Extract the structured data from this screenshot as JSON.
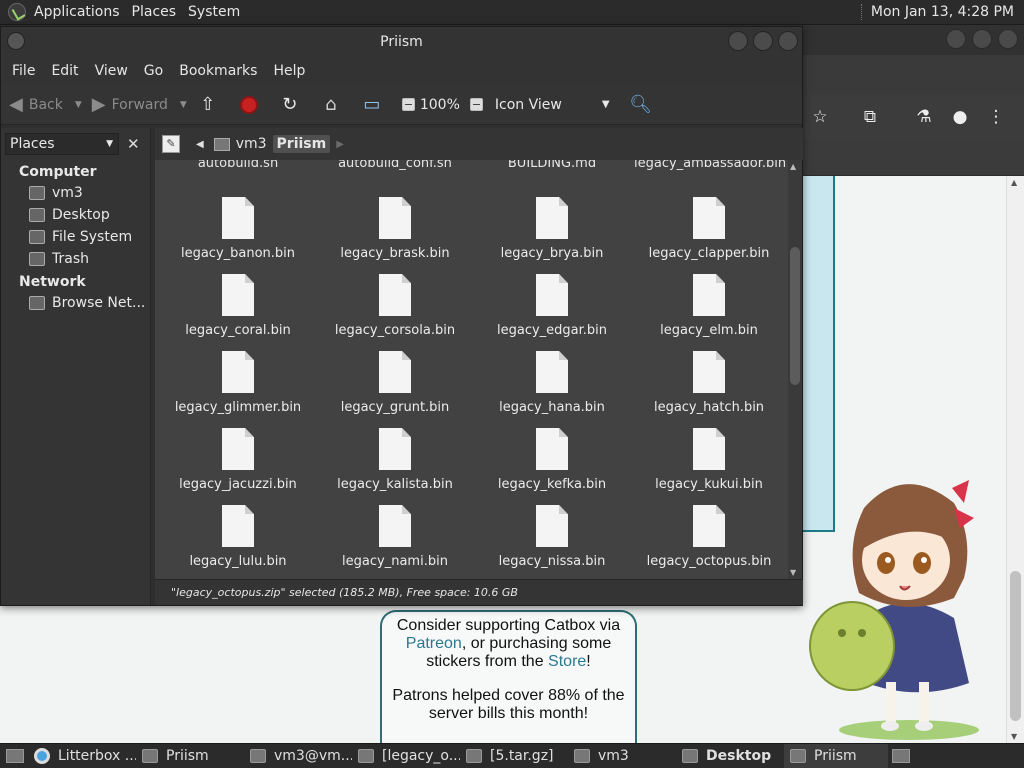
{
  "top_panel": {
    "menus": [
      "Applications",
      "Places",
      "System"
    ],
    "clock": "Mon Jan 13,  4:28 PM"
  },
  "browser": {
    "support": {
      "line1_pre": "Consider supporting Catbox via",
      "patreon": "Patreon",
      "line2_mid": ", or purchasing some",
      "line3_pre": "stickers from the ",
      "store": "Store",
      "line3_post": "!",
      "patrons": "Patrons helped cover 88% of the server bills this month!"
    }
  },
  "file_manager": {
    "title": "Priism",
    "menus": [
      "File",
      "Edit",
      "View",
      "Go",
      "Bookmarks",
      "Help"
    ],
    "toolbar": {
      "back": "Back",
      "forward": "Forward",
      "zoom": "100%",
      "view_mode": "Icon View"
    },
    "sidebar": {
      "selector": "Places",
      "categories": [
        {
          "label": "Computer",
          "items": [
            "vm3",
            "Desktop",
            "File System",
            "Trash"
          ]
        },
        {
          "label": "Network",
          "items": [
            "Browse Net..."
          ]
        }
      ]
    },
    "path": [
      "vm3",
      "Priism"
    ],
    "partial_files": [
      "autobuild.sh",
      "autobuild_conf.sh",
      "BUILDING.md",
      "legacy_ambassador.bin"
    ],
    "files": [
      "legacy_banon.bin",
      "legacy_brask.bin",
      "legacy_brya.bin",
      "legacy_clapper.bin",
      "legacy_coral.bin",
      "legacy_corsola.bin",
      "legacy_edgar.bin",
      "legacy_elm.bin",
      "legacy_glimmer.bin",
      "legacy_grunt.bin",
      "legacy_hana.bin",
      "legacy_hatch.bin",
      "legacy_jacuzzi.bin",
      "legacy_kalista.bin",
      "legacy_kefka.bin",
      "legacy_kukui.bin",
      "legacy_lulu.bin",
      "legacy_nami.bin",
      "legacy_nissa.bin",
      "legacy_octopus.bin"
    ],
    "status": "\"legacy_octopus.zip\" selected (185.2 MB), Free space: 10.6 GB"
  },
  "taskbar": {
    "tasks": [
      "Litterbox ...",
      "Priism",
      "vm3@vm...",
      "[legacy_o...",
      "[5.tar.gz]",
      "vm3",
      "Desktop",
      "Priism"
    ]
  }
}
